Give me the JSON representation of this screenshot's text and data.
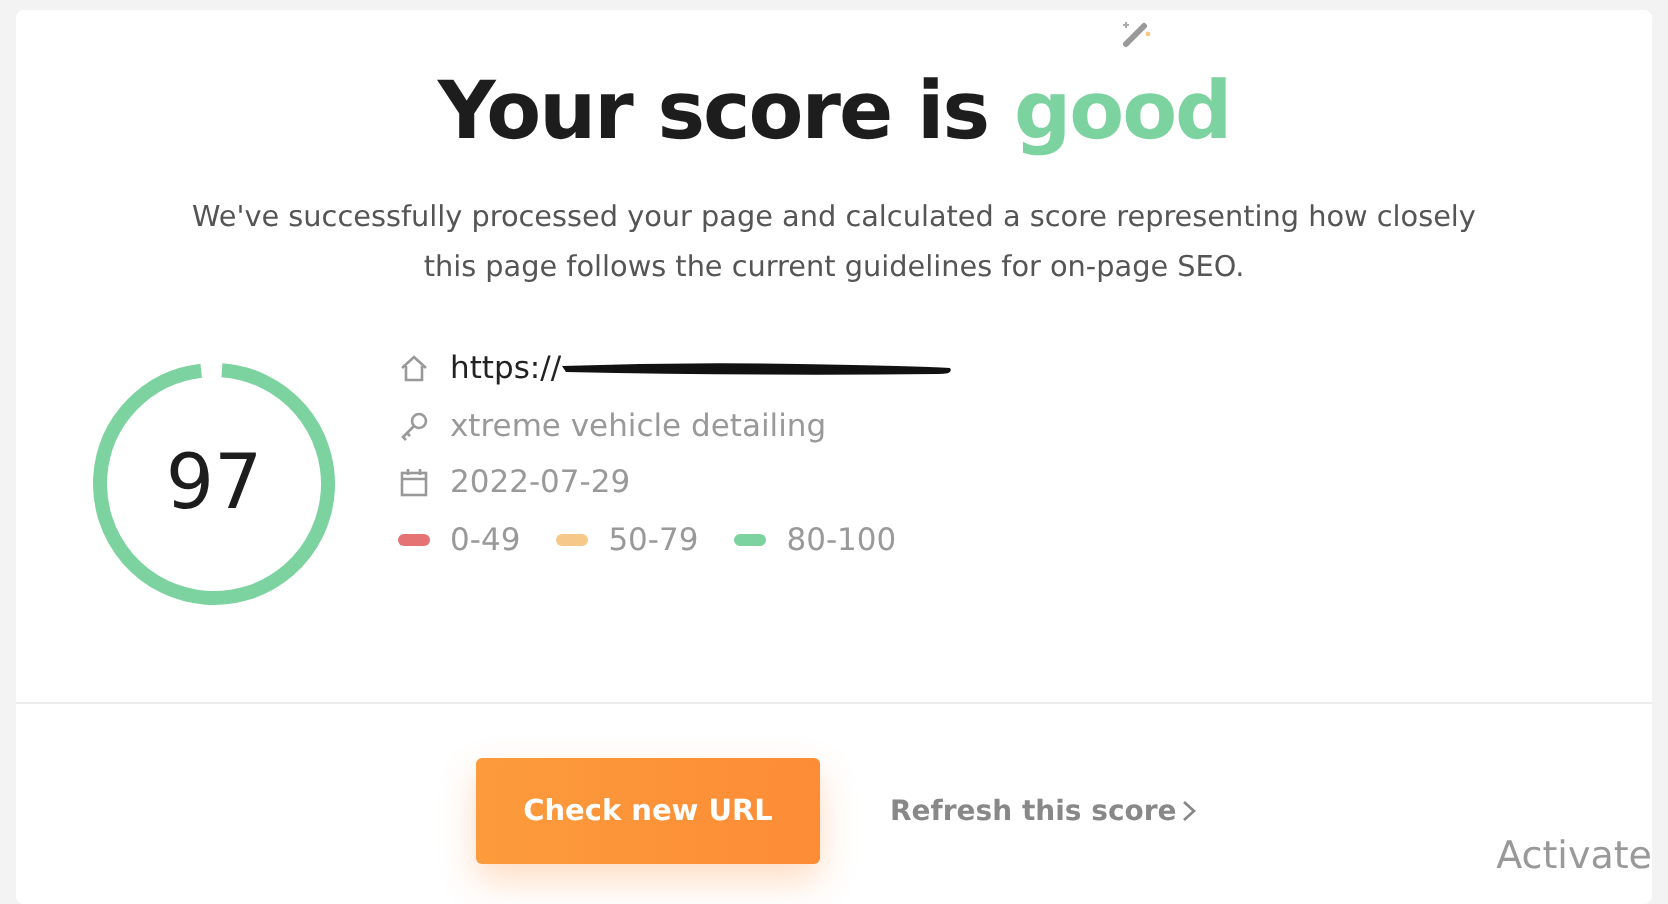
{
  "heading": {
    "text": "Your score is",
    "rating": "good"
  },
  "description": "We've successfully processed your page and calculated a score representing how closely this page follows the current guidelines for on-page SEO.",
  "score": {
    "value": "97",
    "level": 0.97,
    "color": "#7dd3a0"
  },
  "details": [
    {
      "kind": "url",
      "text": "https://",
      "redacted": true
    },
    {
      "kind": "keyword",
      "text": "xtreme vehicle detailing"
    },
    {
      "kind": "date",
      "text": "2022-07-29"
    }
  ],
  "legend": [
    {
      "label": "0-49",
      "color": "#e57373"
    },
    {
      "label": "50-79",
      "color": "#f6c88a"
    },
    {
      "label": "80-100",
      "color": "#7dd3a0"
    }
  ],
  "actions": {
    "primary": "Check new URL",
    "link": "Refresh this score"
  },
  "system_overlay": {
    "text": "Activate"
  }
}
